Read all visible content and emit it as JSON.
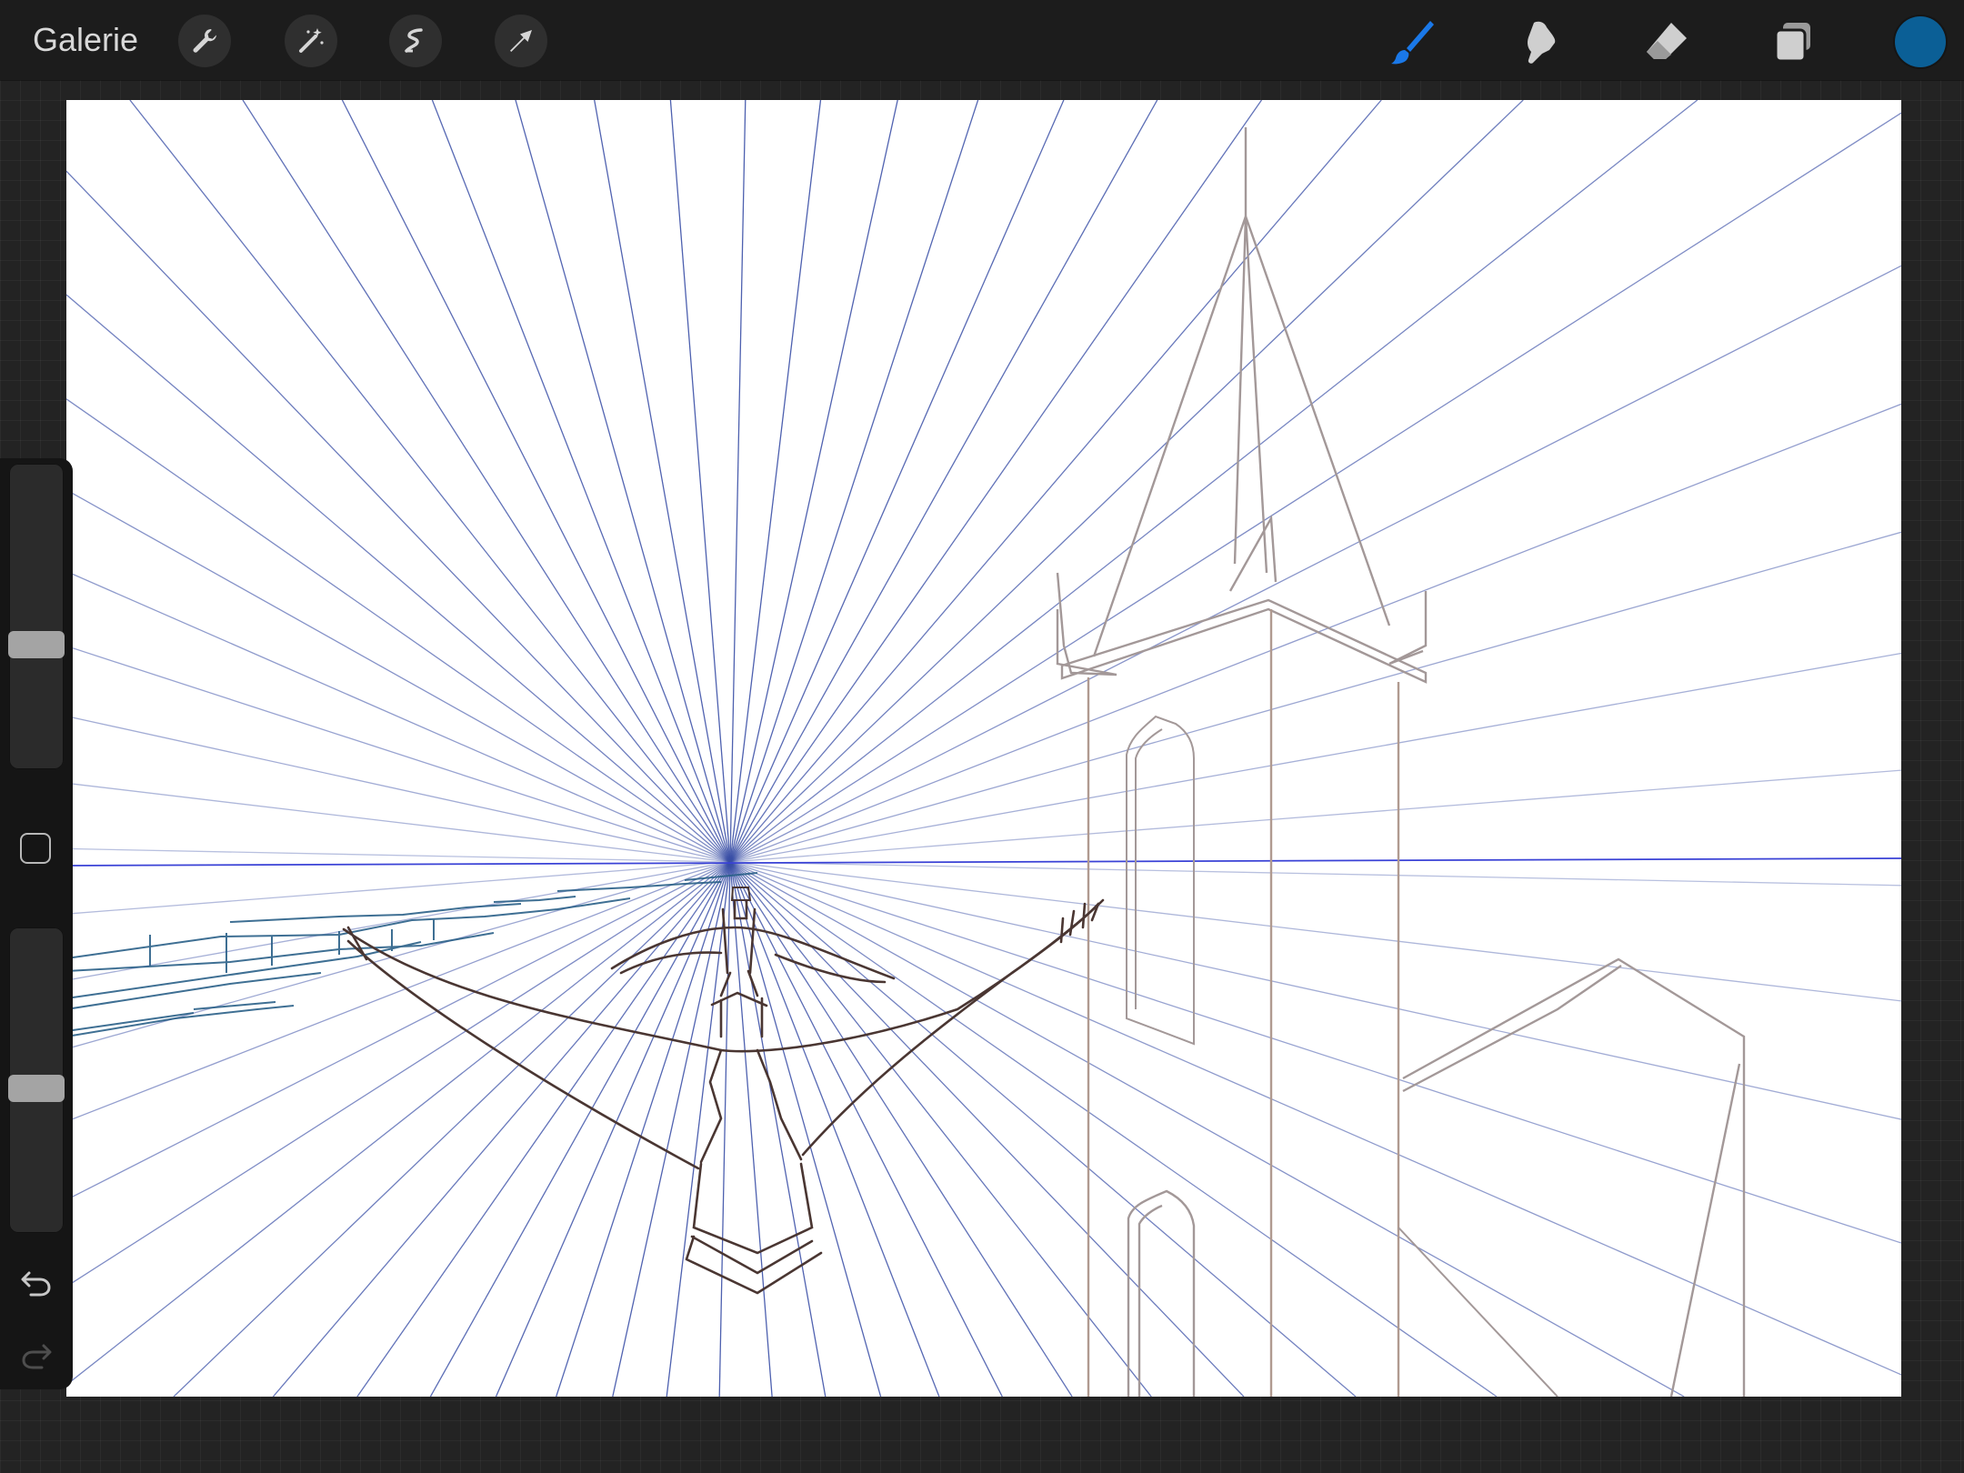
{
  "toolbar": {
    "gallery_label": "Galerie",
    "left_tools": [
      "wrench-icon",
      "magic-wand-icon",
      "selection-icon",
      "transform-arrow-icon"
    ],
    "right_tools": [
      "brush-icon",
      "smudge-icon",
      "eraser-icon",
      "layers-icon"
    ],
    "active_tool": "brush",
    "accent_color": "#1a78e8",
    "current_color": "#0b5f96"
  },
  "sidebar": {
    "brush_size_level": 0.4,
    "opacity_level": 0.47,
    "buttons": [
      "modify-button",
      "undo-icon",
      "redo-icon"
    ]
  },
  "canvas": {
    "guide_color": "#3a4fa6",
    "background": "#ffffff"
  }
}
